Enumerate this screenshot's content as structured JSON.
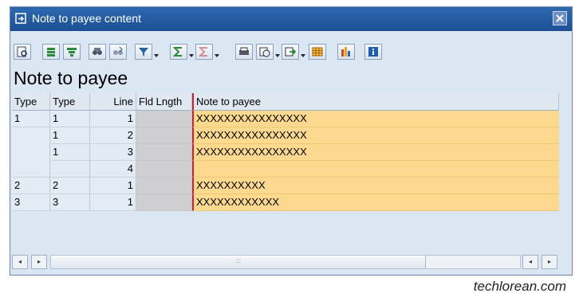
{
  "window": {
    "title": "Note to payee content",
    "close_icon": "close-icon"
  },
  "heading": "Note to payee",
  "toolbar": {
    "buttons": [
      "details-icon",
      "sort-ascending-icon",
      "sort-descending-icon",
      "find-icon",
      "find-next-icon",
      "filter-icon",
      "sum-icon",
      "subtotal-icon",
      "print-preview-icon",
      "view-icon",
      "export-icon",
      "layout-icon",
      "graphic-icon",
      "information-icon"
    ]
  },
  "table": {
    "columns": [
      "Type",
      "Type",
      "Line",
      "Fld Lngth",
      "Note to payee"
    ],
    "rows": [
      {
        "type1": "1",
        "type2": "1",
        "line": "1",
        "fld": "",
        "note": "XXXXXXXXXXXXXXXX"
      },
      {
        "type1": "",
        "type2": "1",
        "line": "2",
        "fld": "",
        "note": "XXXXXXXXXXXXXXXX"
      },
      {
        "type1": "",
        "type2": "1",
        "line": "3",
        "fld": "",
        "note": "XXXXXXXXXXXXXXXX"
      },
      {
        "type1": "",
        "type2": "",
        "line": "4",
        "fld": "",
        "note": ""
      },
      {
        "type1": "2",
        "type2": "2",
        "line": "1",
        "fld": "",
        "note": "XXXXXXXXXX"
      },
      {
        "type1": "3",
        "type2": "3",
        "line": "1",
        "fld": "",
        "note": "XXXXXXXXXXXX"
      }
    ]
  },
  "scrollbar": {
    "left_arrow": "◂",
    "right_arrow": "▸",
    "grip": ":::"
  },
  "watermark": "techlorean.com",
  "colors": {
    "titlebar": "#1d4f94",
    "panel": "#dae6f2",
    "highlight": "#fcd98f",
    "grey_cell": "#cfcfd2"
  }
}
